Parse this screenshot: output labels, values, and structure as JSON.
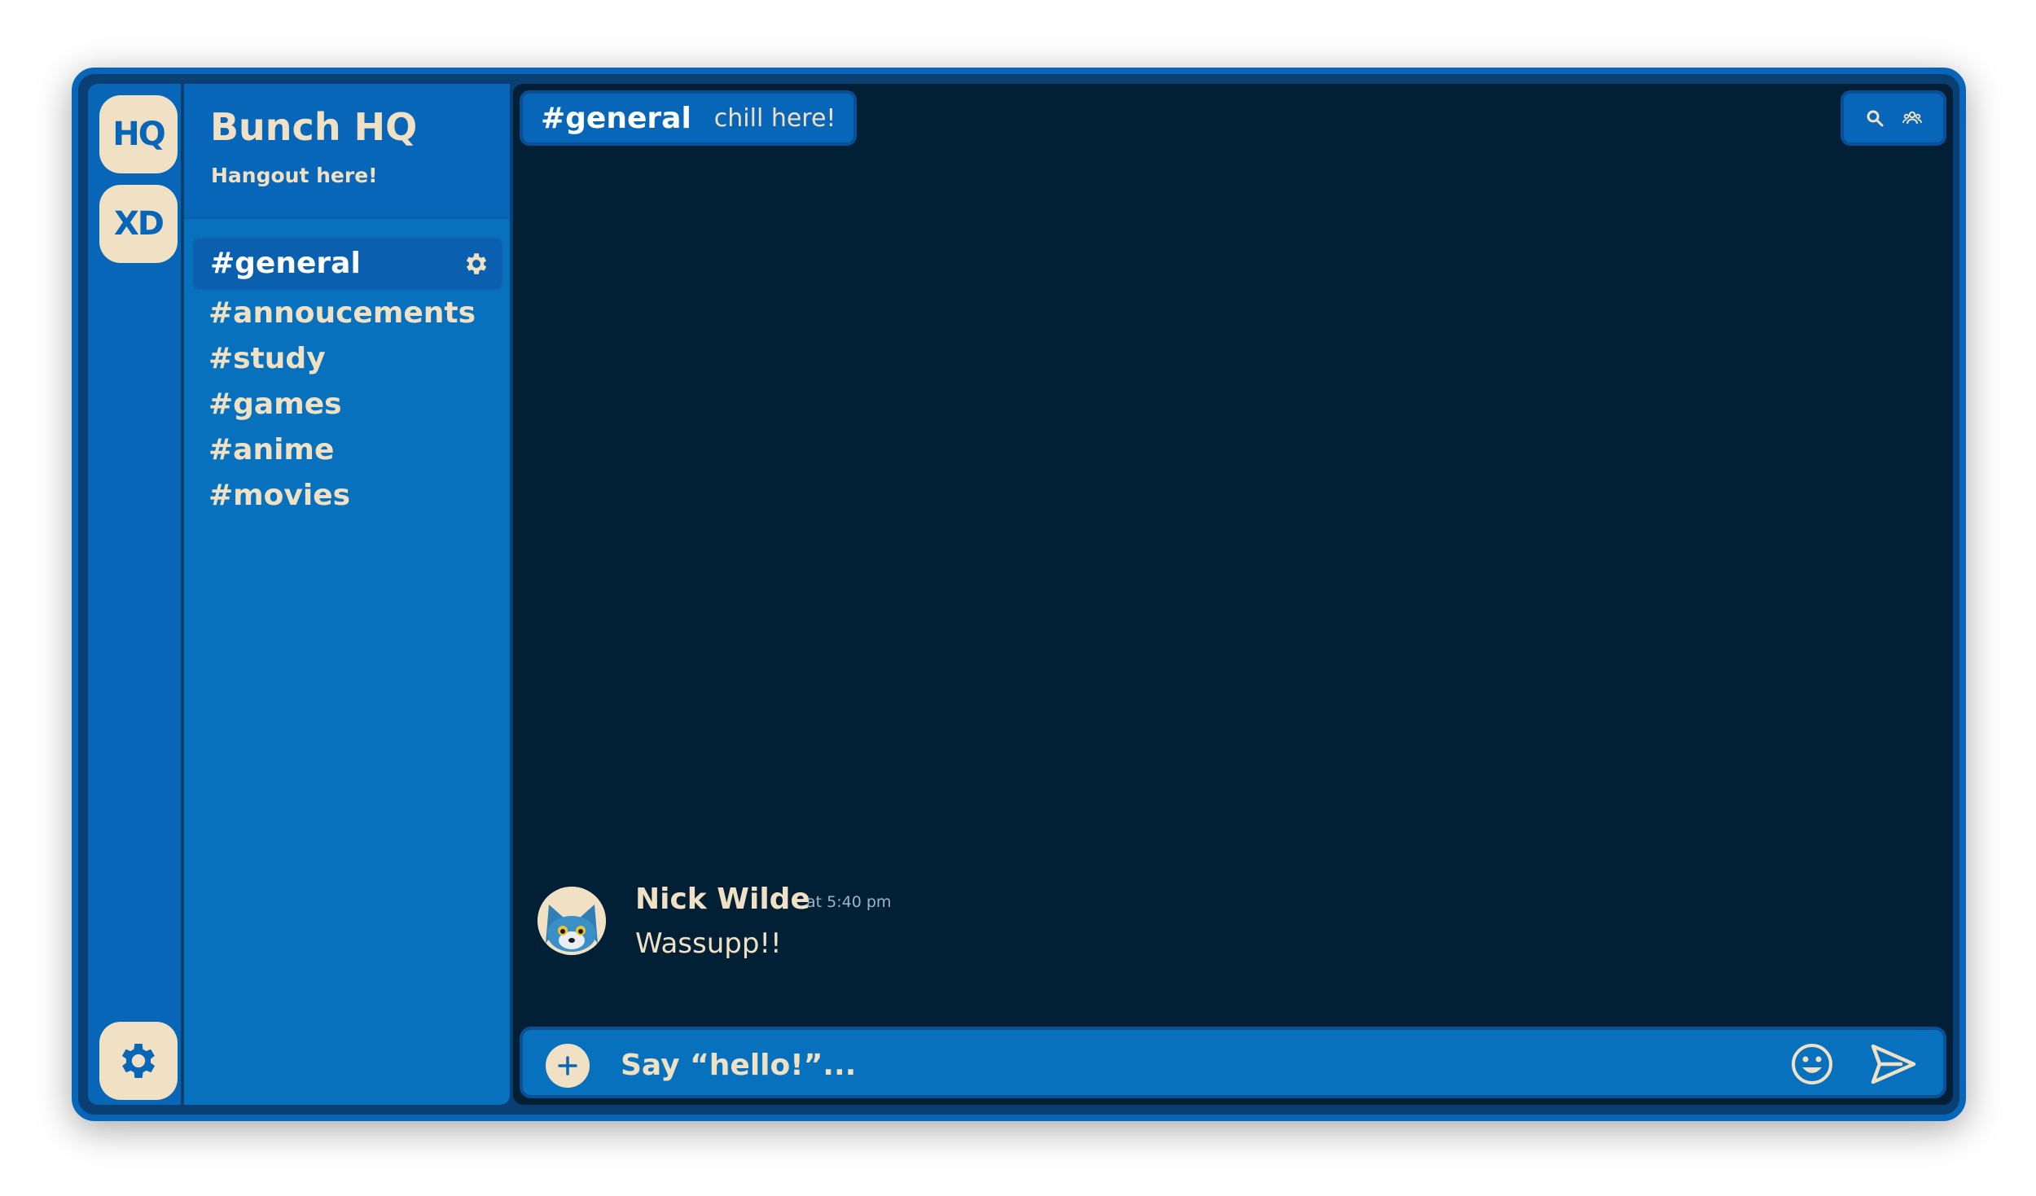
{
  "servers": [
    {
      "label": "HQ"
    },
    {
      "label": "XD"
    }
  ],
  "server": {
    "title": "Bunch HQ",
    "subtitle": "Hangout here!"
  },
  "channels": [
    {
      "label": "#general",
      "active": true
    },
    {
      "label": "#annoucements"
    },
    {
      "label": "#study"
    },
    {
      "label": "#games"
    },
    {
      "label": "#anime"
    },
    {
      "label": "#movies"
    }
  ],
  "topic": {
    "name": "#general",
    "description": "chill here!"
  },
  "message": {
    "author": "Nick Wilde",
    "time": "at 5:40 pm",
    "text": "Wassupp!!"
  },
  "composer": {
    "placeholder": "Say “hello!”..."
  },
  "icons": {
    "channel_settings": "gear-icon",
    "rail_settings": "gear-icon",
    "search": "search-icon",
    "members": "members-icon",
    "add": "plus-icon",
    "emoji": "smiley-icon",
    "send": "send-icon"
  },
  "colors": {
    "cream": "#f0e1c4",
    "blue": "#0766b7",
    "panel": "#0771bd",
    "dark": "#012035"
  }
}
